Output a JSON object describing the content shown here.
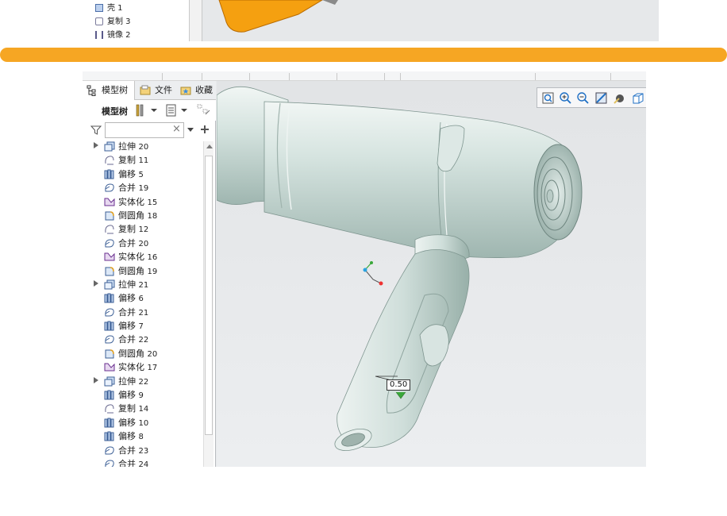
{
  "top_tree": {
    "items": [
      {
        "label": "壳 1"
      },
      {
        "label": "复制 3"
      },
      {
        "label": "镜像 2"
      }
    ]
  },
  "panel": {
    "tabs": [
      {
        "label": "模型树"
      },
      {
        "label": "文件"
      },
      {
        "label": "收藏"
      }
    ],
    "toolbar_title": "模型树",
    "filter": {
      "value": "",
      "clear": "×"
    }
  },
  "tree": {
    "rows": [
      {
        "label": "拉伸",
        "num": "20",
        "icon": "extrude-icon",
        "expand": true
      },
      {
        "label": "复制",
        "num": "11",
        "icon": "copy-icon",
        "expand": false
      },
      {
        "label": "偏移",
        "num": "5",
        "icon": "offset-icon",
        "expand": false
      },
      {
        "label": "合并",
        "num": "19",
        "icon": "merge-icon",
        "expand": false
      },
      {
        "label": "实体化",
        "num": "15",
        "icon": "solidify-icon",
        "expand": false
      },
      {
        "label": "倒圆角",
        "num": "18",
        "icon": "round-icon",
        "expand": false
      },
      {
        "label": "复制",
        "num": "12",
        "icon": "copy-icon",
        "expand": false
      },
      {
        "label": "合并",
        "num": "20",
        "icon": "merge-icon",
        "expand": false
      },
      {
        "label": "实体化",
        "num": "16",
        "icon": "solidify-icon",
        "expand": false
      },
      {
        "label": "倒圆角",
        "num": "19",
        "icon": "round-icon",
        "expand": false
      },
      {
        "label": "拉伸",
        "num": "21",
        "icon": "extrude-icon",
        "expand": true
      },
      {
        "label": "偏移",
        "num": "6",
        "icon": "offset-icon",
        "expand": false
      },
      {
        "label": "合并",
        "num": "21",
        "icon": "merge-icon",
        "expand": false
      },
      {
        "label": "偏移",
        "num": "7",
        "icon": "offset-icon",
        "expand": false
      },
      {
        "label": "合并",
        "num": "22",
        "icon": "merge-icon",
        "expand": false
      },
      {
        "label": "倒圆角",
        "num": "20",
        "icon": "round-icon",
        "expand": false
      },
      {
        "label": "实体化",
        "num": "17",
        "icon": "solidify-icon",
        "expand": false
      },
      {
        "label": "拉伸",
        "num": "22",
        "icon": "extrude-icon",
        "expand": true
      },
      {
        "label": "偏移",
        "num": "9",
        "icon": "offset-icon",
        "expand": false
      },
      {
        "label": "复制",
        "num": "14",
        "icon": "copy-icon",
        "expand": false
      },
      {
        "label": "偏移",
        "num": "10",
        "icon": "offset-icon",
        "expand": false
      },
      {
        "label": "偏移",
        "num": "8",
        "icon": "offset-icon",
        "expand": false
      },
      {
        "label": "合并",
        "num": "23",
        "icon": "merge-icon",
        "expand": false
      },
      {
        "label": "合并",
        "num": "24",
        "icon": "merge-icon",
        "expand": false
      }
    ]
  },
  "viewport": {
    "dimension": "0.50",
    "model": "hair-dryer-3d-model"
  },
  "colors": {
    "accent_bar": "#f6a623",
    "model_body": "#d3e2de",
    "top_model": "#f5a010"
  }
}
